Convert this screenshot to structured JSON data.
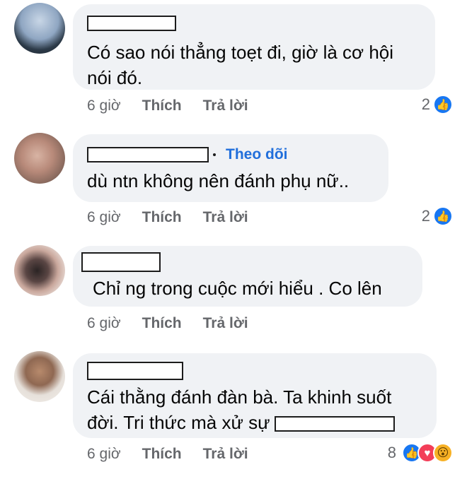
{
  "comments": [
    {
      "text": "Có sao nói thẳng toẹt đi, giờ là cơ hội nói đó.",
      "time": "6 giờ",
      "like": "Thích",
      "reply": "Trả lời",
      "reaction_count": "2",
      "reactions": [
        "like-icon"
      ]
    },
    {
      "follow": "Theo dõi",
      "text": "dù ntn không nên đánh phụ nữ..",
      "time": "6 giờ",
      "like": "Thích",
      "reply": "Trả lời",
      "reaction_count": "2",
      "reactions": [
        "like-icon"
      ]
    },
    {
      "text": "Chỉ ng trong cuộc mới hiểu . Co lên",
      "time": "6 giờ",
      "like": "Thích",
      "reply": "Trả lời"
    },
    {
      "text": "Cái thằng đánh đàn bà. Ta khinh suốt đời. Tri thức mà xử sự",
      "time": "6 giờ",
      "like": "Thích",
      "reply": "Trả lời",
      "reaction_count": "8",
      "reactions": [
        "like-icon",
        "love-icon",
        "wow-icon"
      ]
    }
  ],
  "colors": {
    "bubble": "#f0f2f5",
    "link": "#216fdb",
    "meta": "#65676b",
    "like": "#1877f2",
    "love": "#f33e58",
    "wow": "#f7b125"
  }
}
